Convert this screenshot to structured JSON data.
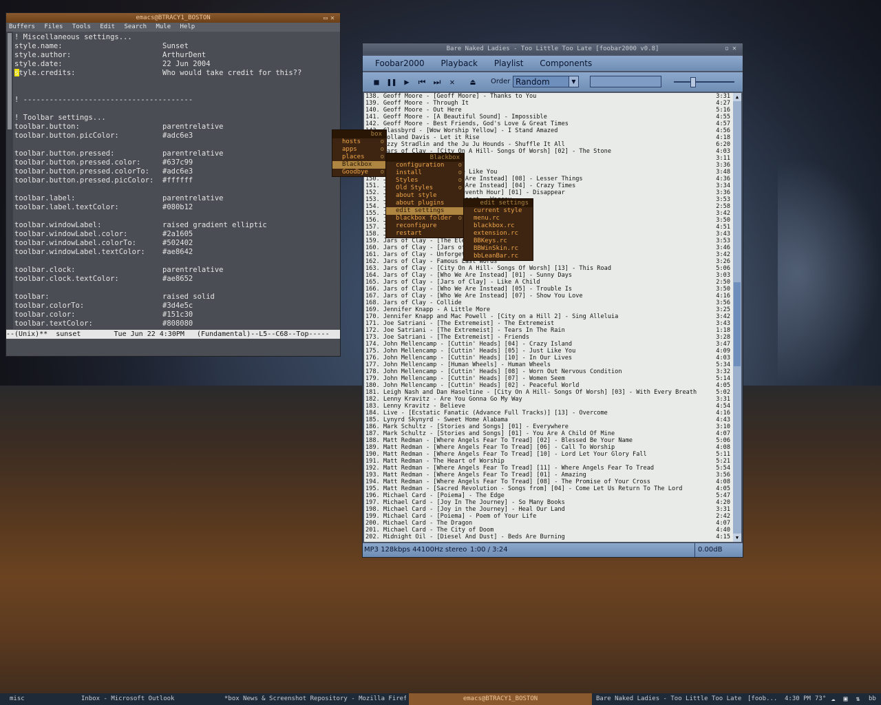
{
  "emacs": {
    "title": "emacs@BTRACY1_BOSTON",
    "menus": [
      "Buffers",
      "Files",
      "Tools",
      "Edit",
      "Search",
      "Mule",
      "Help"
    ],
    "lines": [
      {
        "k": "! Miscellaneous settings...",
        "v": ""
      },
      {
        "k": "style.name:",
        "v": "Sunset"
      },
      {
        "k": "style.author:",
        "v": "ArthurDent"
      },
      {
        "k": "style.date:",
        "v": "22 Jun 2004"
      },
      {
        "k": "style.credits:",
        "v": "Who would take credit for this??"
      },
      {
        "k": "",
        "v": ""
      },
      {
        "k": "",
        "v": ""
      },
      {
        "k": "! ---------------------------------------",
        "v": ""
      },
      {
        "k": "",
        "v": ""
      },
      {
        "k": "! Toolbar settings...",
        "v": ""
      },
      {
        "k": "toolbar.button:",
        "v": "parentrelative"
      },
      {
        "k": "toolbar.button.picColor:",
        "v": "#adc6e3"
      },
      {
        "k": "",
        "v": ""
      },
      {
        "k": "toolbar.button.pressed:",
        "v": "parentrelative"
      },
      {
        "k": "toolbar.button.pressed.color:",
        "v": "#637c99"
      },
      {
        "k": "toolbar.button.pressed.colorTo:",
        "v": "#adc6e3"
      },
      {
        "k": "toolbar.button.pressed.picColor:",
        "v": "#ffffff"
      },
      {
        "k": "",
        "v": ""
      },
      {
        "k": "toolbar.label:",
        "v": "parentrelative"
      },
      {
        "k": "toolbar.label.textColor:",
        "v": "#080b12"
      },
      {
        "k": "",
        "v": ""
      },
      {
        "k": "toolbar.windowLabel:",
        "v": "raised gradient elliptic"
      },
      {
        "k": "toolbar.windowLabel.color:",
        "v": "#2a1605"
      },
      {
        "k": "toolbar.windowLabel.colorTo:",
        "v": "#502402"
      },
      {
        "k": "toolbar.windowLabel.textColor:",
        "v": "#ae8642"
      },
      {
        "k": "",
        "v": ""
      },
      {
        "k": "toolbar.clock:",
        "v": "parentrelative"
      },
      {
        "k": "toolbar.clock.textColor:",
        "v": "#ae8652"
      },
      {
        "k": "",
        "v": ""
      },
      {
        "k": "toolbar:",
        "v": "raised solid"
      },
      {
        "k": "toolbar.colorTo:",
        "v": "#3d4e5c"
      },
      {
        "k": "toolbar.color:",
        "v": "#151c30"
      },
      {
        "k": "toolbar.textColor:",
        "v": "#808080"
      }
    ],
    "modeline": "--(Unix)**  sunset        Tue Jun 22 4:30PM   (Fundamental)--L5--C68--Top-----"
  },
  "foobar": {
    "title": "Bare Naked Ladies - Too Little Too Late     [foobar2000 v0.8]",
    "menus": [
      "Foobar2000",
      "Playback",
      "Playlist",
      "Components"
    ],
    "order_label": "Order",
    "order_value": "Random",
    "status_format": "MP3 128kbps 44100Hz stereo",
    "status_position": "1:00 / 3:24",
    "status_gain": "0.00dB",
    "playlist": [
      {
        "t": "138. Geoff Moore - [Geoff Moore] - Thanks to You",
        "d": "3:31"
      },
      {
        "t": "139. Geoff Moore - Through It",
        "d": "4:27"
      },
      {
        "t": "140. Geoff Moore - Out Here",
        "d": "5:16"
      },
      {
        "t": "141. Geoff Moore - [A Beautiful Sound] - Impossible",
        "d": "4:55"
      },
      {
        "t": "142. Geoff Moore - Best Friends, God's Love & Great Times",
        "d": "4:57"
      },
      {
        "t": "143. Glassbyrd - [Wow Worship Yellow] - I Stand Amazed",
        "d": "4:56"
      },
      {
        "t": "144. Holland Davis - Let it Rise",
        "d": "4:18"
      },
      {
        "t": "145. Izzy Stradlin and the Ju Ju Hounds - Shuffle It All",
        "d": "6:20"
      },
      {
        "t": "146. Jars of Clay - [City On A Hill- Songs Of Worsh] [02] - The Stone",
        "d": "4:03"
      },
      {
        "t": "147. Jars of Clay",
        "d": "3:11"
      },
      {
        "t": "148. Jars of Clay",
        "d": "3:36"
      },
      {
        "t": "149. Jars of Clay - Loves Me Like You",
        "d": "3:48"
      },
      {
        "t": "150. Jars of Clay - [Who We Are Instead] [08] - Lesser Things",
        "d": "4:36"
      },
      {
        "t": "151. Jars of Clay - [Who We Are Instead] [04] - Crazy Times",
        "d": "3:34"
      },
      {
        "t": "152. Jars of Clay - [The Eleventh Hour] [01] - Disappear",
        "d": "3:36"
      },
      {
        "t": "153. Jars of Clay - Worlds Apart - Worrey",
        "d": "3:53"
      },
      {
        "t": "154. Jars of Clay - Revelation",
        "d": "2:58"
      },
      {
        "t": "155. Jars of Clay - Redemption",
        "d": "3:42"
      },
      {
        "t": "156. Jars of Clay - Something Beautiful",
        "d": "3:50"
      },
      {
        "t": "157. Jars of Clay - Sympathy",
        "d": "4:51"
      },
      {
        "t": "158. Jars of Clay - Whatever She Wants",
        "d": "3:43"
      },
      {
        "t": "159. Jars of Clay - [The Eleventh Hour]",
        "d": "3:53"
      },
      {
        "t": "160. Jars of Clay - [Jars of Clay]",
        "d": "3:46"
      },
      {
        "t": "161. Jars of Clay - Unforgetful You",
        "d": "3:42"
      },
      {
        "t": "162. Jars of Clay - Famous Last Words",
        "d": "3:26"
      },
      {
        "t": "163. Jars of Clay - [City On A Hill- Songs Of Worsh] [13] - This Road",
        "d": "5:06"
      },
      {
        "t": "164. Jars of Clay - [Who We Are Instead] [01] - Sunny Days",
        "d": "3:03"
      },
      {
        "t": "165. Jars of Clay - [Jars of Clay] - Like A Child",
        "d": "2:50"
      },
      {
        "t": "166. Jars of Clay - [Who We Are Instead] [05] - Trouble Is",
        "d": "3:50"
      },
      {
        "t": "167. Jars of Clay - [Who We Are Instead] [07] - Show You Love",
        "d": "4:16"
      },
      {
        "t": "168. Jars of Clay - Collide",
        "d": "3:56"
      },
      {
        "t": "169. Jennifer Knapp - A Little More",
        "d": "3:25"
      },
      {
        "t": "170. Jennifer Knapp and Mac Powell - [City on a Hill 2] - Sing Alleluia",
        "d": "3:42"
      },
      {
        "t": "171. Joe Satriani - [The Extremeist] - The Extremeist",
        "d": "3:43"
      },
      {
        "t": "172. Joe Satriani - [The Extremeist] - Tears In The Rain",
        "d": "1:18"
      },
      {
        "t": "173. Joe Satriani - [The Extremeist] - Friends",
        "d": "3:28"
      },
      {
        "t": "174. John Mellencamp - [Cuttin' Heads] [04] - Crazy Island",
        "d": "3:47"
      },
      {
        "t": "175. John Mellencamp - [Cuttin' Heads] [05] - Just Like You",
        "d": "4:09"
      },
      {
        "t": "176. John Mellencamp - [Cuttin' Heads] [10] - In Our Lives",
        "d": "4:03"
      },
      {
        "t": "177. John Mellencamp - [Human Wheels] - Human Wheels",
        "d": "5:34"
      },
      {
        "t": "178. John Mellencamp - [Cuttin' Heads] [08] - Worn Out Nervous Condition",
        "d": "3:32"
      },
      {
        "t": "179. John Mellencamp - [Cuttin' Heads] [07] - Women Seem",
        "d": "5:14"
      },
      {
        "t": "180. John Mellencamp - [Cuttin' Heads] [02] - Peaceful World",
        "d": "4:05"
      },
      {
        "t": "181. Leigh Nash and Dan Haseltine - [City On A Hill- Songs Of Worsh] [03] - With Every Breath",
        "d": "5:02"
      },
      {
        "t": "182. Lenny Kravitz - Are You Gonna Go My Way",
        "d": "3:31"
      },
      {
        "t": "183. Lenny Kravitz - Believe",
        "d": "4:54"
      },
      {
        "t": "184. Live - [Ecstatic Fanatic (Advance Full Tracks)] [13] - Overcome",
        "d": "4:16"
      },
      {
        "t": "185. Lynyrd Skynyrd - Sweet Home Alabama",
        "d": "4:43"
      },
      {
        "t": "186. Mark Schultz - [Stories and Songs] [01] - Everywhere",
        "d": "3:10"
      },
      {
        "t": "187. Mark Schultz - [Stories and Songs] [01] - You Are A Child Of Mine",
        "d": "4:07"
      },
      {
        "t": "188. Matt Redman - [Where Angels Fear To Tread] [02] - Blessed Be Your Name",
        "d": "5:06"
      },
      {
        "t": "189. Matt Redman - [Where Angels Fear To Tread] [06] - Call To Worship",
        "d": "4:08"
      },
      {
        "t": "190. Matt Redman - [Where Angels Fear To Tread] [10] - Lord Let Your Glory Fall",
        "d": "5:11"
      },
      {
        "t": "191. Matt Redman - The Heart of Worship",
        "d": "5:21"
      },
      {
        "t": "192. Matt Redman - [Where Angels Fear To Tread] [11] - Where Angels Fear To Tread",
        "d": "5:54"
      },
      {
        "t": "193. Matt Redman - [Where Angels Fear To Tread] [01] - Amazing",
        "d": "3:56"
      },
      {
        "t": "194. Matt Redman - [Where Angels Fear To Tread] [08] - The Promise of Your Cross",
        "d": "4:08"
      },
      {
        "t": "195. Matt Redman - [Sacred Revolution - Songs from] [04] - Come Let Us Return To The Lord",
        "d": "4:05"
      },
      {
        "t": "196. Michael Card - [Poiema] - The Edge",
        "d": "5:47"
      },
      {
        "t": "197. Michael Card - [Joy In The Journey] - So Many Books",
        "d": "4:20"
      },
      {
        "t": "198. Michael Card - [Joy in the Journey] - Heal Our Land",
        "d": "3:31"
      },
      {
        "t": "199. Michael Card - [Poiema] - Poem of Your Life",
        "d": "2:42"
      },
      {
        "t": "200. Michael Card - The Dragon",
        "d": "4:07"
      },
      {
        "t": "201. Michael Card - The City of Doom",
        "d": "4:40"
      },
      {
        "t": "202. Midnight Oil - [Diesel And Dust] - Beds Are Burning",
        "d": "4:15"
      }
    ]
  },
  "menus": {
    "root": {
      "title": "box",
      "items": [
        "hosts",
        "apps",
        "places",
        "Blackbox",
        "Goodbye"
      ]
    },
    "blackbox": {
      "title": "Blackbox",
      "items": [
        "configuration",
        "install",
        "Styles",
        "Old Styles",
        "about style",
        "about plugins",
        "edit settings",
        "blackbox folder",
        "reconfigure",
        "restart"
      ]
    },
    "edit": {
      "title": "edit settings",
      "items": [
        "current style",
        "menu.rc",
        "blackbox.rc",
        "extension.rc",
        "BBKeys.rc",
        "BBWinSkin.rc",
        "bbLeanBar.rc"
      ]
    }
  },
  "taskbar": {
    "tasks": [
      "misc",
      "Inbox - Microsoft Outlook",
      "*box News & Screenshot Repository - Mozilla Firefox",
      "emacs@BTRACY1_BOSTON",
      "Bare Naked Ladies - Too Little Too Late",
      "[foob..."
    ],
    "clock": "4:30 PM",
    "temp": "73°",
    "tray_label": "bb"
  }
}
